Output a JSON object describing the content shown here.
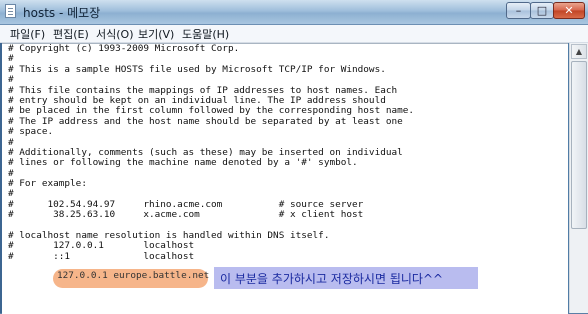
{
  "window": {
    "title": "hosts - 메모장",
    "min_symbol": "–",
    "max_symbol": "□",
    "close_symbol": "✕"
  },
  "menu": [
    {
      "label": "파일(F)"
    },
    {
      "label": "편집(E)"
    },
    {
      "label": "서식(O)"
    },
    {
      "label": "보기(V)"
    },
    {
      "label": "도움말(H)"
    }
  ],
  "document": {
    "lines": [
      "# Copyright (c) 1993-2009 Microsoft Corp.",
      "#",
      "# This is a sample HOSTS file used by Microsoft TCP/IP for Windows.",
      "#",
      "# This file contains the mappings of IP addresses to host names. Each",
      "# entry should be kept on an individual line. The IP address should",
      "# be placed in the first column followed by the corresponding host name.",
      "# The IP address and the host name should be separated by at least one",
      "# space.",
      "#",
      "# Additionally, comments (such as these) may be inserted on individual",
      "# lines or following the machine name denoted by a '#' symbol.",
      "#",
      "# For example:",
      "#",
      "#      102.54.94.97     rhino.acme.com          # source server",
      "#       38.25.63.10     x.acme.com              # x client host",
      "",
      "# localhost name resolution is handled within DNS itself.",
      "#       127.0.0.1       localhost",
      "#       ::1             localhost"
    ],
    "highlighted_entry": "127.0.0.1 europe.battle.net"
  },
  "annotation": {
    "text": "이 부분을 추가하시고 저장하시면 됩니다^^"
  }
}
